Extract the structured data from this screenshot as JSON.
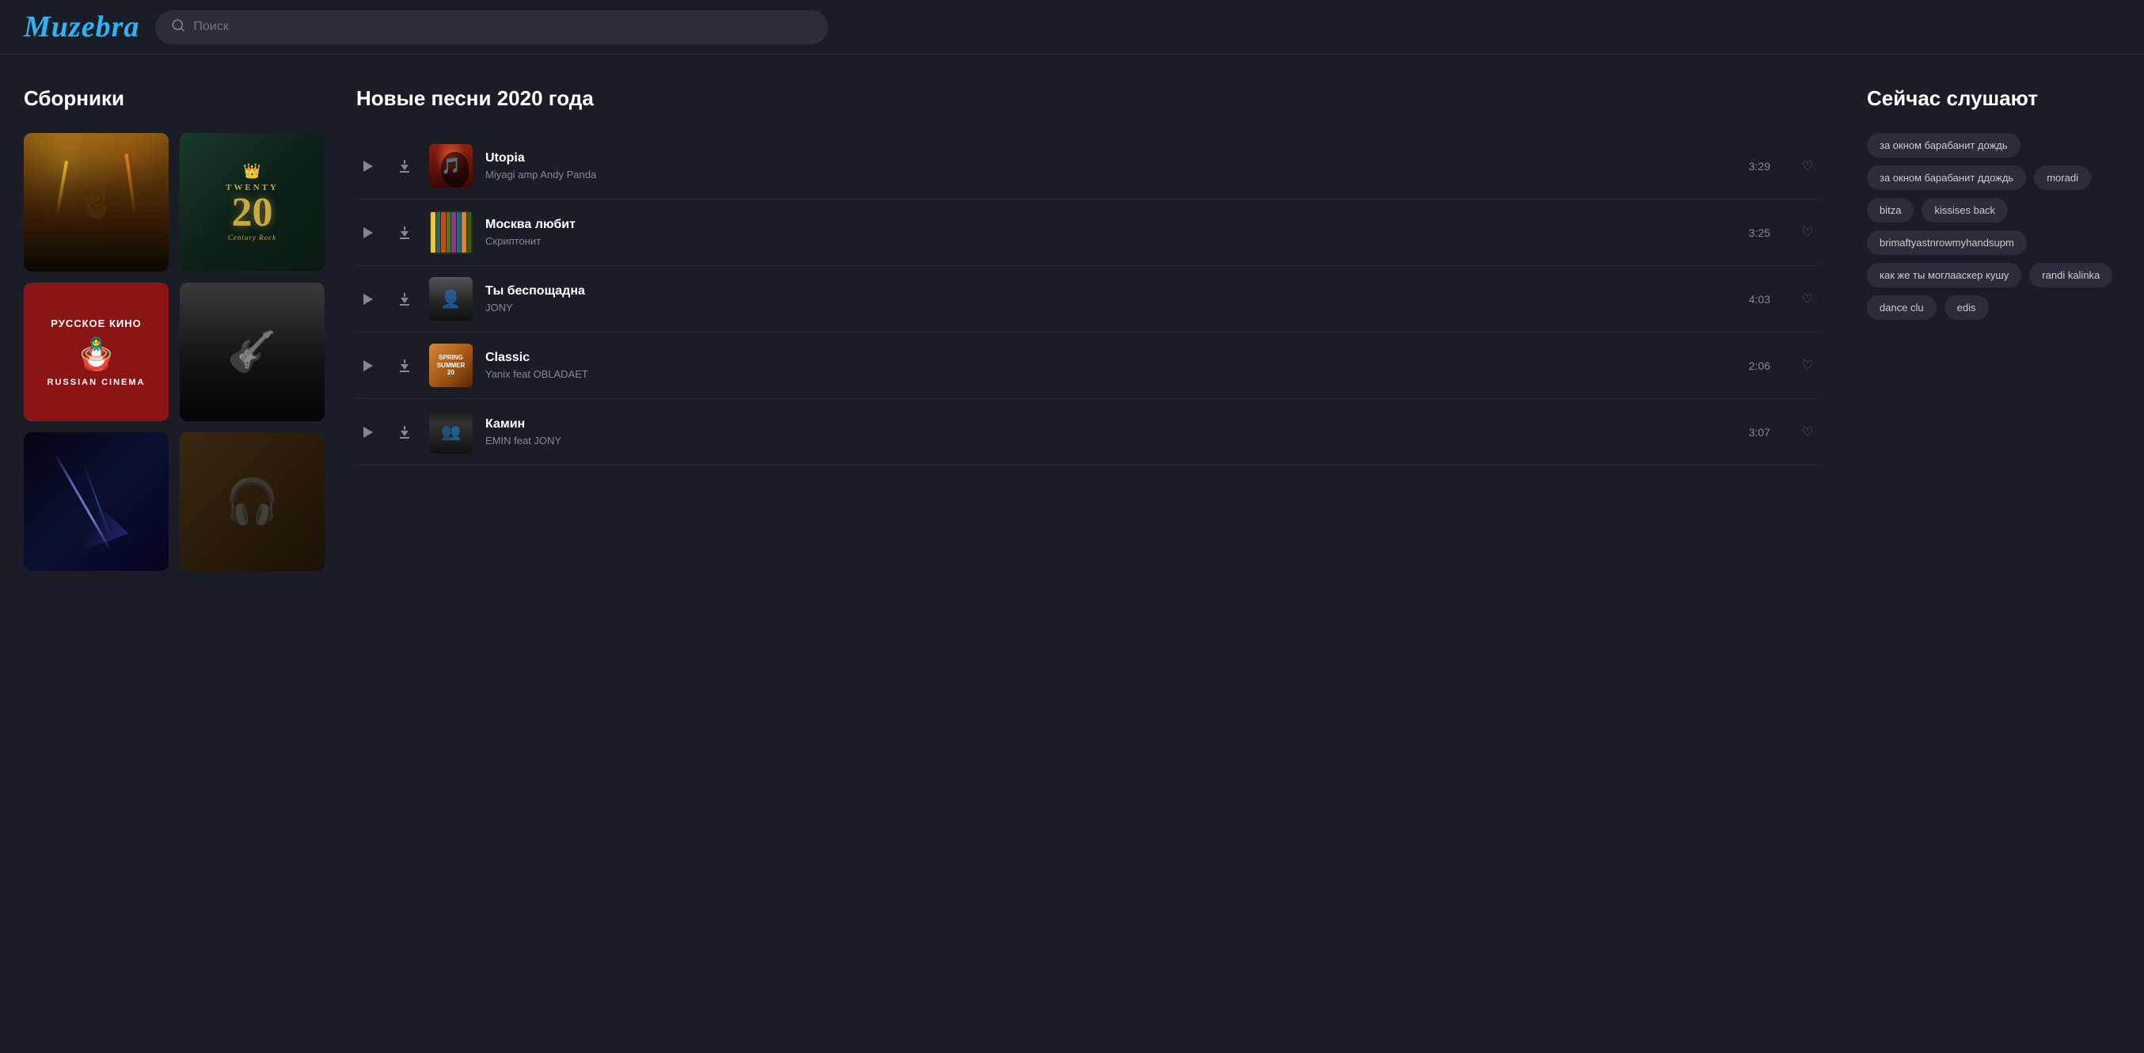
{
  "app": {
    "name": "Muzebra",
    "logo": "Muzebra"
  },
  "header": {
    "search_placeholder": "Поиск"
  },
  "sections": {
    "collections": {
      "title": "Сборники",
      "items": [
        {
          "id": "concert",
          "type": "concert",
          "label": "Концерт"
        },
        {
          "id": "twenty",
          "type": "twenty",
          "label": "Twenty Century Rock",
          "line1": "TwENTY",
          "line2": "20",
          "line3": "Century Rock"
        },
        {
          "id": "russian-cinema",
          "type": "russian",
          "label": "Русское кино",
          "line1": "РУССКОЕ КИНО",
          "line2": "RUSSIAN CINEMA"
        },
        {
          "id": "bw-rock",
          "type": "bw",
          "label": "Рок"
        },
        {
          "id": "space",
          "type": "space",
          "label": "Космос"
        },
        {
          "id": "headphones",
          "type": "headphones",
          "label": "Наушники"
        }
      ]
    },
    "new_songs": {
      "title": "Новые песни 2020 года",
      "songs": [
        {
          "id": 1,
          "title": "Utopia",
          "artist": "Miyagi amp Andy Panda",
          "duration": "3:29",
          "cover_type": "utopia"
        },
        {
          "id": 2,
          "title": "Москва любит",
          "artist": "Скриптонит",
          "duration": "3:25",
          "cover_type": "moskva"
        },
        {
          "id": 3,
          "title": "Ты беспощадна",
          "artist": "JONY",
          "duration": "4:03",
          "cover_type": "merciless"
        },
        {
          "id": 4,
          "title": "Classic",
          "artist": "Yanix feat OBLADAET",
          "duration": "2:06",
          "cover_type": "classic"
        },
        {
          "id": 5,
          "title": "Камин",
          "artist": "EMIN feat JONY",
          "duration": "3:07",
          "cover_type": "kamin"
        }
      ]
    },
    "now_listening": {
      "title": "Сейчас слушают",
      "tags": [
        {
          "id": 1,
          "label": "за окном барабанит дождь"
        },
        {
          "id": 2,
          "label": "за окном барабанит ддождь"
        },
        {
          "id": 3,
          "label": "moradi"
        },
        {
          "id": 4,
          "label": "bitza"
        },
        {
          "id": 5,
          "label": "kissises back"
        },
        {
          "id": 6,
          "label": "brimaftyastnrowmyhandsupm"
        },
        {
          "id": 7,
          "label": "как же ты моглааскер кушу"
        },
        {
          "id": 8,
          "label": "randi kalinka"
        },
        {
          "id": 9,
          "label": "dance clu"
        },
        {
          "id": 10,
          "label": "edis"
        }
      ]
    }
  }
}
